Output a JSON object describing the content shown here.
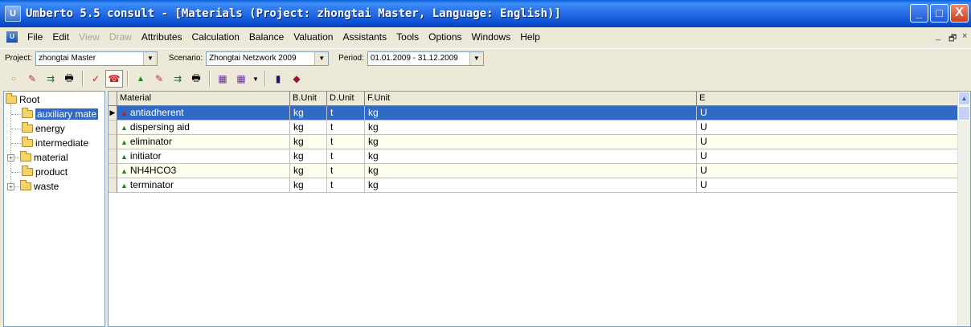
{
  "window": {
    "app_icon": "U",
    "title": "Umberto 5.5 consult - [Materials (Project: zhongtai Master, Language: English)]",
    "minimize": "_",
    "maximize": "□",
    "close": "X"
  },
  "menu": {
    "items": [
      {
        "label": "File",
        "enabled": true
      },
      {
        "label": "Edit",
        "enabled": true
      },
      {
        "label": "View",
        "enabled": false
      },
      {
        "label": "Draw",
        "enabled": false
      },
      {
        "label": "Attributes",
        "enabled": true
      },
      {
        "label": "Calculation",
        "enabled": true
      },
      {
        "label": "Balance",
        "enabled": true
      },
      {
        "label": "Valuation",
        "enabled": true
      },
      {
        "label": "Assistants",
        "enabled": true
      },
      {
        "label": "Tools",
        "enabled": true
      },
      {
        "label": "Options",
        "enabled": true
      },
      {
        "label": "Windows",
        "enabled": true
      },
      {
        "label": "Help",
        "enabled": true
      }
    ],
    "mdi_minimize": "_",
    "mdi_restore": "🗗",
    "mdi_close": "×"
  },
  "selectors": {
    "project_label": "Project:",
    "project_value": "zhongtai Master",
    "scenario_label": "Scenario:",
    "scenario_value": "Zhongtai Netzwork 2009",
    "period_label": "Period:",
    "period_value": "01.01.2009 - 31.12.2009"
  },
  "tree": {
    "root": "Root",
    "items": [
      {
        "label": "auxiliary mate",
        "expandable": false,
        "selected": true
      },
      {
        "label": "energy",
        "expandable": false,
        "selected": false
      },
      {
        "label": "intermediate",
        "expandable": false,
        "selected": false
      },
      {
        "label": "material",
        "expandable": true,
        "selected": false
      },
      {
        "label": "product",
        "expandable": false,
        "selected": false
      },
      {
        "label": "waste",
        "expandable": true,
        "selected": false
      }
    ]
  },
  "grid": {
    "columns": [
      "Material",
      "B.Unit",
      "D.Unit",
      "F.Unit",
      "E"
    ],
    "rows": [
      {
        "material": "antiadherent",
        "b_unit": "kg",
        "d_unit": "t",
        "f_unit": "kg",
        "e": "U",
        "marker_color": "#d01010"
      },
      {
        "material": "dispersing aid",
        "b_unit": "kg",
        "d_unit": "t",
        "f_unit": "kg",
        "e": "U",
        "marker_color": "#108a10"
      },
      {
        "material": "eliminator",
        "b_unit": "kg",
        "d_unit": "t",
        "f_unit": "kg",
        "e": "U",
        "marker_color": "#108a10"
      },
      {
        "material": "initiator",
        "b_unit": "kg",
        "d_unit": "t",
        "f_unit": "kg",
        "e": "U",
        "marker_color": "#108a10"
      },
      {
        "material": "NH4HCO3",
        "b_unit": "kg",
        "d_unit": "t",
        "f_unit": "kg",
        "e": "U",
        "marker_color": "#108a10"
      },
      {
        "material": "terminator",
        "b_unit": "kg",
        "d_unit": "t",
        "f_unit": "kg",
        "e": "U",
        "marker_color": "#108a10"
      }
    ],
    "selected_row": 0,
    "row_pointer": "▶"
  },
  "colors": {
    "titlebar": "#0a4fcf",
    "selection": "#316ac5",
    "row_alt": "#fffff0"
  }
}
